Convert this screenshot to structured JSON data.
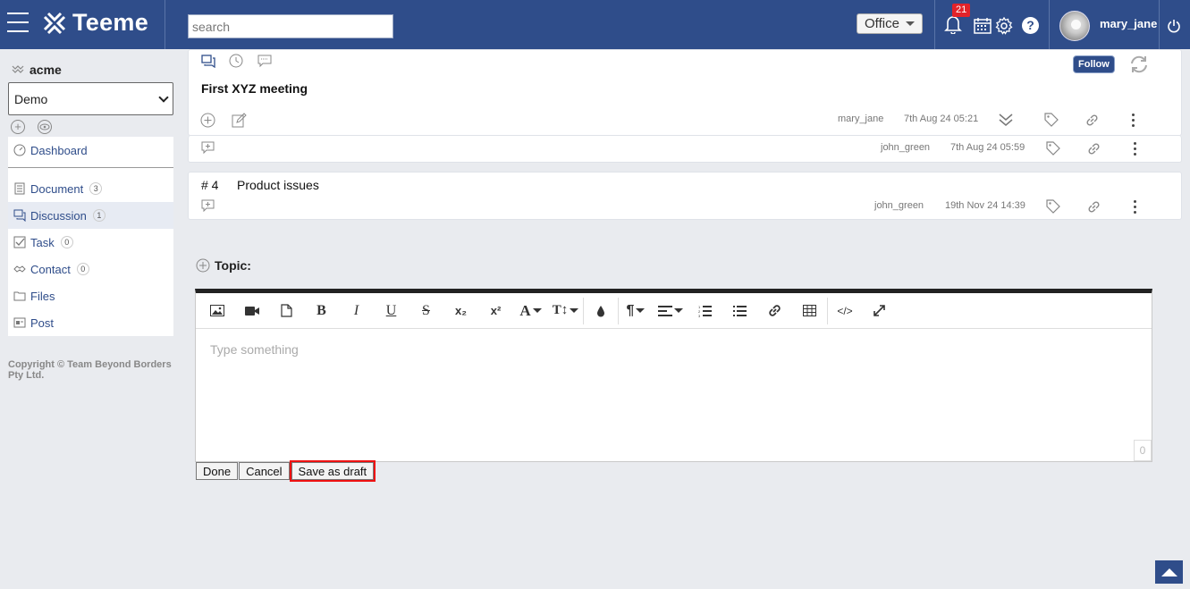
{
  "header": {
    "app_name": "Teeme",
    "search_placeholder": "search",
    "office_label": "Office",
    "notification_count": "21",
    "help_label": "?",
    "username": "mary_jane"
  },
  "sidebar": {
    "org_name": "acme",
    "workspace": "Demo",
    "items": [
      {
        "label": "Dashboard",
        "icon": "dashboard-icon"
      },
      {
        "label": "Document",
        "count": "3",
        "icon": "document-icon"
      },
      {
        "label": "Discussion",
        "count": "1",
        "icon": "discussion-icon"
      },
      {
        "label": "Task",
        "count": "0",
        "icon": "task-icon"
      },
      {
        "label": "Contact",
        "count": "0",
        "icon": "contact-icon"
      },
      {
        "label": "Files",
        "icon": "files-icon"
      },
      {
        "label": "Post",
        "icon": "post-icon"
      }
    ],
    "copyright": "Copyright © Team Beyond Borders Pty Ltd."
  },
  "thread": {
    "follow_label": "Follow",
    "title": "First XYZ meeting",
    "author": "mary_jane",
    "timestamp": "7th Aug 24 05:21",
    "reply": {
      "author": "john_green",
      "timestamp": "7th Aug 24 05:59"
    }
  },
  "topic2": {
    "number": "# 4",
    "title": "Product issues",
    "author": "john_green",
    "timestamp": "19th Nov 24 14:39"
  },
  "editor": {
    "topic_label": "Topic:",
    "placeholder": "Type something",
    "char_count": "0",
    "done_label": "Done",
    "cancel_label": "Cancel",
    "draft_label": "Save as draft",
    "toolbar": {
      "bold": "B",
      "italic": "I",
      "underline": "U",
      "strike": "S",
      "subscript": "x₂",
      "superscript": "x²",
      "font_color": "A",
      "font_size": "T↕",
      "paragraph": "¶",
      "code": "</>"
    }
  },
  "colors": {
    "brand": "#2f4d8a",
    "badge": "#e2232a",
    "highlight": "#e11111"
  }
}
